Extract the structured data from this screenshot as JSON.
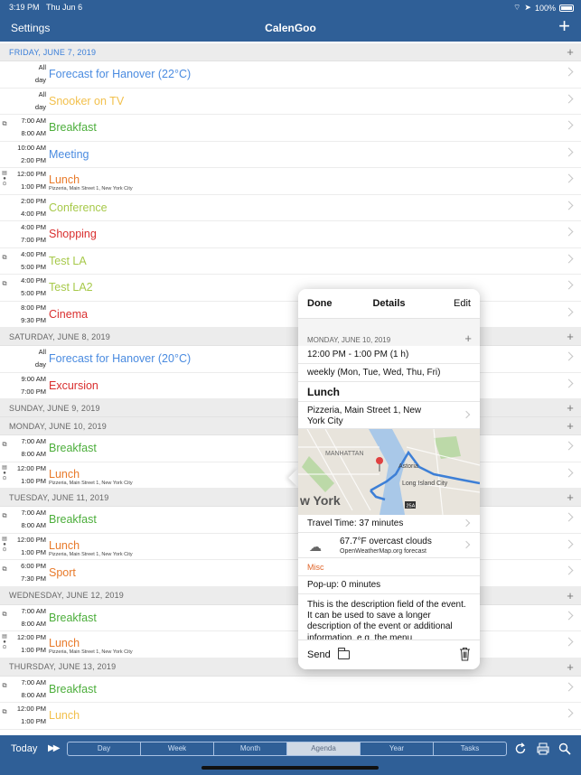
{
  "status": {
    "time": "3:19 PM",
    "date": "Thu Jun 6",
    "battery": "100%"
  },
  "nav": {
    "settings_label": "Settings",
    "title": "CalenGoo"
  },
  "days": [
    {
      "header": "FRIDAY, JUNE 7, 2019",
      "current": true,
      "events": [
        {
          "t1": "All",
          "t2": "day",
          "title": "Forecast for Hanover (22°C)",
          "color": "#4a8be0",
          "icon": ""
        },
        {
          "t1": "All",
          "t2": "day",
          "title": "Snooker on TV",
          "color": "#f2c04c",
          "icon": ""
        },
        {
          "t1": "7:00 AM",
          "t2": "8:00 AM",
          "title": "Breakfast",
          "color": "#4cae3b",
          "icon": "repeat"
        },
        {
          "t1": "10:00 AM",
          "t2": "2:00 PM",
          "title": "Meeting",
          "color": "#4a8be0",
          "icon": ""
        },
        {
          "t1": "12:00 PM",
          "t2": "1:00 PM",
          "title": "Lunch",
          "color": "#e87a2a",
          "location": "Pizzeria, Main Street 1, New York City",
          "icon": "multi"
        },
        {
          "t1": "2:00 PM",
          "t2": "4:00 PM",
          "title": "Conference",
          "color": "#a7c94a",
          "icon": ""
        },
        {
          "t1": "4:00 PM",
          "t2": "7:00 PM",
          "title": "Shopping",
          "color": "#d92f2f",
          "icon": ""
        },
        {
          "t1": "4:00 PM",
          "t2": "5:00 PM",
          "title": "Test LA",
          "color": "#a7c94a",
          "icon": "repeat"
        },
        {
          "t1": "4:00 PM",
          "t2": "5:00 PM",
          "title": "Test LA2",
          "color": "#a7c94a",
          "icon": "repeat"
        },
        {
          "t1": "8:00 PM",
          "t2": "9:30 PM",
          "title": "Cinema",
          "color": "#d92f2f",
          "icon": ""
        }
      ]
    },
    {
      "header": "SATURDAY, JUNE 8, 2019",
      "current": false,
      "events": [
        {
          "t1": "All",
          "t2": "day",
          "title": "Forecast for Hanover (20°C)",
          "color": "#4a8be0",
          "icon": ""
        },
        {
          "t1": "9:00 AM",
          "t2": "7:00 PM",
          "title": "Excursion",
          "color": "#d92f2f",
          "icon": ""
        }
      ]
    },
    {
      "header": "SUNDAY, JUNE 9, 2019",
      "current": false,
      "events": []
    },
    {
      "header": "MONDAY, JUNE 10, 2019",
      "current": false,
      "events": [
        {
          "t1": "7:00 AM",
          "t2": "8:00 AM",
          "title": "Breakfast",
          "color": "#4cae3b",
          "icon": "repeat"
        },
        {
          "t1": "12:00 PM",
          "t2": "1:00 PM",
          "title": "Lunch",
          "color": "#e87a2a",
          "location": "Pizzeria, Main Street 1, New York City",
          "icon": "multi"
        }
      ]
    },
    {
      "header": "TUESDAY, JUNE 11, 2019",
      "current": false,
      "events": [
        {
          "t1": "7:00 AM",
          "t2": "8:00 AM",
          "title": "Breakfast",
          "color": "#4cae3b",
          "icon": "repeat"
        },
        {
          "t1": "12:00 PM",
          "t2": "1:00 PM",
          "title": "Lunch",
          "color": "#e87a2a",
          "location": "Pizzeria, Main Street 1, New York City",
          "icon": "multi"
        },
        {
          "t1": "6:00 PM",
          "t2": "7:30 PM",
          "title": "Sport",
          "color": "#e87a2a",
          "icon": "repeat"
        }
      ]
    },
    {
      "header": "WEDNESDAY, JUNE 12, 2019",
      "current": false,
      "events": [
        {
          "t1": "7:00 AM",
          "t2": "8:00 AM",
          "title": "Breakfast",
          "color": "#4cae3b",
          "icon": "repeat"
        },
        {
          "t1": "12:00 PM",
          "t2": "1:00 PM",
          "title": "Lunch",
          "color": "#e87a2a",
          "location": "Pizzeria, Main Street 1, New York City",
          "icon": "multi"
        }
      ]
    },
    {
      "header": "THURSDAY, JUNE 13, 2019",
      "current": false,
      "events": [
        {
          "t1": "7:00 AM",
          "t2": "8:00 AM",
          "title": "Breakfast",
          "color": "#4cae3b",
          "icon": "repeat"
        },
        {
          "t1": "12:00 PM",
          "t2": "1:00 PM",
          "title": "Lunch",
          "color": "#f2c04c",
          "icon": "repeat"
        }
      ]
    }
  ],
  "popover": {
    "done_label": "Done",
    "title": "Details",
    "edit_label": "Edit",
    "date": "MONDAY, JUNE 10, 2019",
    "time": "12:00 PM - 1:00 PM (1 h)",
    "repeat": "weekly (Mon, Tue, Wed, Thu, Fri)",
    "event_title": "Lunch",
    "location_line1": "Pizzeria, Main Street 1, New",
    "location_line2": "York City",
    "map_labels": {
      "manhattan": "MANHATTAN",
      "astoria": "Astoria",
      "lic": "Long Island City",
      "newyork": "w York",
      "route": "25A"
    },
    "travel": "Travel Time: 37 minutes",
    "weather_title": "67.7°F overcast clouds",
    "weather_source": "OpenWeatherMap.org forecast",
    "misc_label": "Misc",
    "popup": "Pop-up: 0 minutes",
    "description": "This is the description field of the event. It can be used to save a longer description of the event or additional information, e.g. the menu",
    "send_label": "Send"
  },
  "toolbar": {
    "today_label": "Today",
    "tabs": [
      "Day",
      "Week",
      "Month",
      "Agenda",
      "Year",
      "Tasks"
    ],
    "active_tab": "Agenda"
  }
}
